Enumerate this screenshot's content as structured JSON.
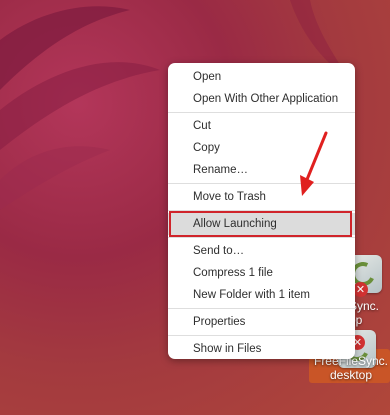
{
  "menu": {
    "items": [
      {
        "label": "Open"
      },
      {
        "label": "Open With Other Application"
      },
      {
        "label": "Cut"
      },
      {
        "label": "Copy"
      },
      {
        "label": "Rename…"
      },
      {
        "label": "Move to Trash"
      },
      {
        "label": "Allow Launching"
      },
      {
        "label": "Send to…"
      },
      {
        "label": "Compress 1 file"
      },
      {
        "label": "New Folder with 1 item"
      },
      {
        "label": "Properties"
      },
      {
        "label": "Show in Files"
      }
    ],
    "highlighted_item": "Allow Launching"
  },
  "desktop_icons": [
    {
      "label_line1": "eFileSync.",
      "label_line2": "ktop"
    },
    {
      "label_line1": "FreeFileSync.",
      "label_line2": "desktop"
    }
  ],
  "colors": {
    "highlight_border": "#d0242b",
    "arrow": "#e0201f",
    "selected_icon_bg": "#c95527"
  }
}
